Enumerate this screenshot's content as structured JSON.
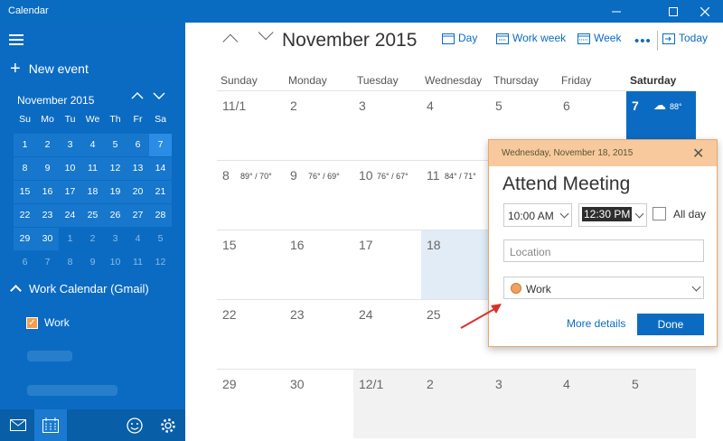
{
  "window": {
    "title": "Calendar"
  },
  "sidebar": {
    "new_event_label": "New event",
    "mini_month": "November 2015",
    "weekdays": [
      "Su",
      "Mo",
      "Tu",
      "We",
      "Th",
      "Fr",
      "Sa"
    ],
    "days": [
      [
        "1",
        "2",
        "3",
        "4",
        "5",
        "6",
        "7"
      ],
      [
        "8",
        "9",
        "10",
        "11",
        "12",
        "13",
        "14"
      ],
      [
        "15",
        "16",
        "17",
        "18",
        "19",
        "20",
        "21"
      ],
      [
        "22",
        "23",
        "24",
        "25",
        "26",
        "27",
        "28"
      ],
      [
        "29",
        "30",
        "1",
        "2",
        "3",
        "4",
        "5"
      ],
      [
        "6",
        "7",
        "8",
        "9",
        "10",
        "11",
        "12"
      ]
    ],
    "calendar_group": "Work Calendar (Gmail)",
    "calendars": [
      {
        "label": "Work",
        "checked": true,
        "color": "#f0a050"
      }
    ]
  },
  "toolbar": {
    "month_label": "November 2015",
    "day": "Day",
    "work_week": "Work week",
    "week": "Week",
    "more": "•••",
    "today": "Today"
  },
  "grid": {
    "headers": [
      "Sunday",
      "Monday",
      "Tuesday",
      "Wednesday",
      "Thursday",
      "Friday",
      "Saturday"
    ],
    "weeks": [
      [
        {
          "n": "11/1"
        },
        {
          "n": "2"
        },
        {
          "n": "3"
        },
        {
          "n": "4"
        },
        {
          "n": "5"
        },
        {
          "n": "6"
        },
        {
          "n": "7",
          "w": "88°",
          "today": true
        }
      ],
      [
        {
          "n": "8",
          "w": "89° / 70°"
        },
        {
          "n": "9",
          "w": "76° / 69°"
        },
        {
          "n": "10",
          "w": "76° / 67°"
        },
        {
          "n": "11",
          "w": "84° / 71°"
        },
        {
          "n": ""
        },
        {
          "n": ""
        },
        {
          "n": ""
        }
      ],
      [
        {
          "n": "15"
        },
        {
          "n": "16"
        },
        {
          "n": "17"
        },
        {
          "n": "18",
          "sel": true
        },
        {
          "n": ""
        },
        {
          "n": ""
        },
        {
          "n": ""
        }
      ],
      [
        {
          "n": "22"
        },
        {
          "n": "23"
        },
        {
          "n": "24"
        },
        {
          "n": "25"
        },
        {
          "n": ""
        },
        {
          "n": ""
        },
        {
          "n": ""
        }
      ],
      [
        {
          "n": "29"
        },
        {
          "n": "30"
        },
        {
          "n": "12/1",
          "dim": true
        },
        {
          "n": "2",
          "dim": true
        },
        {
          "n": "3",
          "dim": true
        },
        {
          "n": "4",
          "dim": true
        },
        {
          "n": "5",
          "dim": true
        }
      ]
    ]
  },
  "popup": {
    "date": "Wednesday, November 18, 2015",
    "title": "Attend Meeting",
    "start_time": "10:00 AM",
    "end_time": "12:30 PM",
    "all_day": "All day",
    "location_placeholder": "Location",
    "calendar": "Work",
    "more_details": "More details",
    "done": "Done"
  },
  "colors": {
    "accent": "#0b6bc2",
    "popup_header": "#f8c99d",
    "work": "#f0a060"
  }
}
